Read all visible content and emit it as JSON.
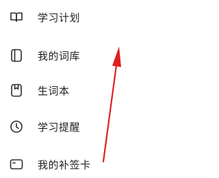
{
  "menu": {
    "items": [
      {
        "label": "学习计划",
        "icon": "open-book-icon"
      },
      {
        "label": "我的词库",
        "icon": "book-icon"
      },
      {
        "label": "生词本",
        "icon": "bookmark-notebook-icon"
      },
      {
        "label": "学习提醒",
        "icon": "clock-icon"
      },
      {
        "label": "我的补签卡",
        "icon": "card-icon"
      }
    ]
  },
  "annotation": {
    "arrow_color": "#e01e1e"
  }
}
